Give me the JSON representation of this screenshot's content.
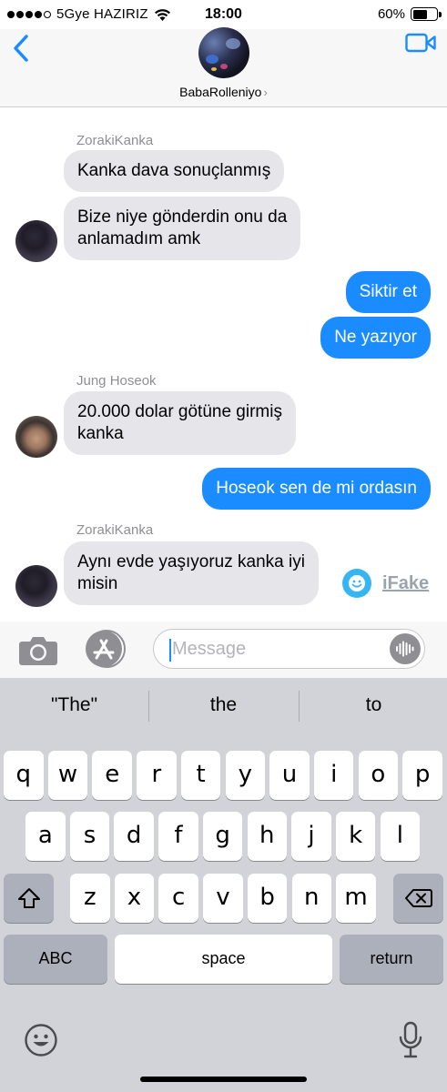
{
  "status_bar": {
    "carrier": "5Gye HAZIRIZ",
    "time": "18:00",
    "battery_percent": "60%",
    "battery_level": 0.6
  },
  "header": {
    "contact_name": "BabaRolleniyo",
    "chevron": "›"
  },
  "messages": [
    {
      "sender": "ZorakiKanka"
    },
    {
      "text": "Kanka dava sonuçlanmış"
    },
    {
      "line1": "Bize niye gönderdin onu da",
      "line2": "anlamadım amk"
    },
    {
      "text": "Siktir et"
    },
    {
      "text": "Ne yazıyor"
    },
    {
      "sender": "Jung Hoseok"
    },
    {
      "line1": "20.000 dolar götüne girmiş",
      "line2": "kanka"
    },
    {
      "text": "Hoseok sen de mi ordasın"
    },
    {
      "sender": "ZorakiKanka"
    },
    {
      "line1": "Aynı evde yaşıyoruz kanka iyi",
      "line2": "misin"
    }
  ],
  "watermark": {
    "text": "iFake"
  },
  "input": {
    "placeholder": "Message",
    "value": ""
  },
  "keyboard": {
    "suggestions": [
      "\"The\"",
      "the",
      "to"
    ],
    "row1": [
      "q",
      "w",
      "e",
      "r",
      "t",
      "y",
      "u",
      "i",
      "o",
      "p"
    ],
    "row2": [
      "a",
      "s",
      "d",
      "f",
      "g",
      "h",
      "j",
      "k",
      "l"
    ],
    "row3": [
      "z",
      "x",
      "c",
      "v",
      "b",
      "n",
      "m"
    ],
    "abc_label": "ABC",
    "space_label": "space",
    "return_label": "return"
  },
  "icons": {
    "back": "chevron-left-icon",
    "video": "video-camera-icon",
    "camera": "camera-icon",
    "app_store": "app-store-icon",
    "audio": "waveform-icon",
    "shift": "shift-icon",
    "delete": "backspace-icon",
    "emoji": "emoji-icon",
    "dictation": "microphone-icon"
  },
  "colors": {
    "accent": "#1a8cff",
    "incoming_bubble": "#e5e5ea",
    "keyboard_bg": "#d1d3d9"
  }
}
